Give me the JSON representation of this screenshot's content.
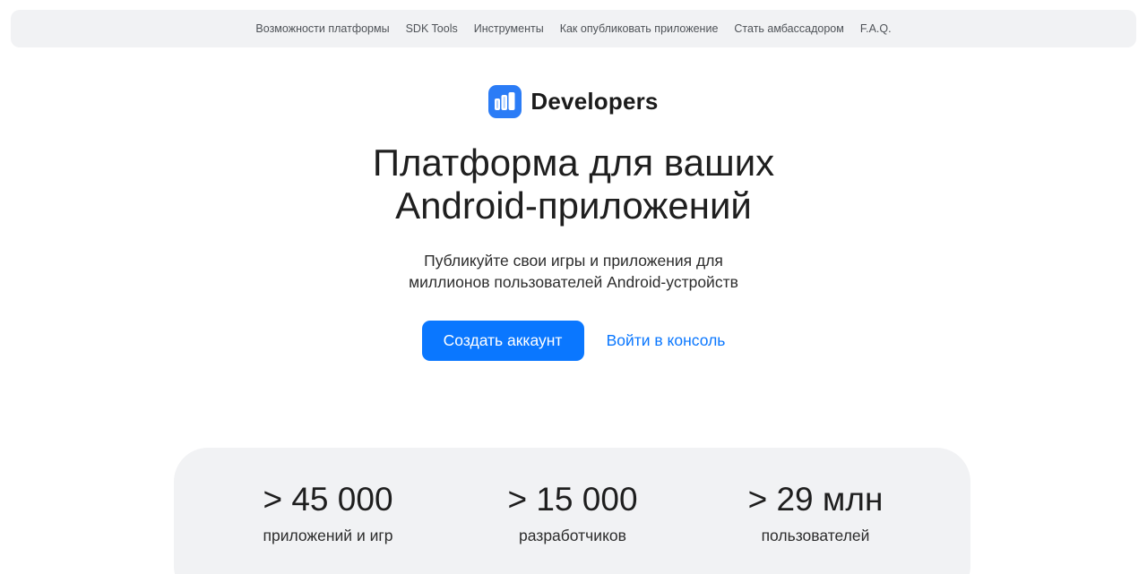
{
  "nav": {
    "items": [
      {
        "label": "Возможности платформы"
      },
      {
        "label": "SDK Tools"
      },
      {
        "label": "Инструменты"
      },
      {
        "label": "Как опубликовать приложение"
      },
      {
        "label": "Стать амбассадором"
      },
      {
        "label": "F.A.Q."
      }
    ]
  },
  "brand": {
    "name": "Developers",
    "logo_icon": "books-icon",
    "color": "#2b7cf6"
  },
  "hero": {
    "title_line1": "Платформа для ваших",
    "title_line2": "Android-приложений",
    "subtitle_line1": "Публикуйте свои игры и приложения для",
    "subtitle_line2": "миллионов пользователей Android-устройств"
  },
  "cta": {
    "primary_label": "Создать аккаунт",
    "secondary_label": "Войти в консоль",
    "accent_color": "#0a77ff"
  },
  "stats": [
    {
      "value": "> 45 000",
      "label": "приложений и игр"
    },
    {
      "value": "> 15 000",
      "label": "разработчиков"
    },
    {
      "value": "> 29 млн",
      "label": "пользователей"
    }
  ]
}
